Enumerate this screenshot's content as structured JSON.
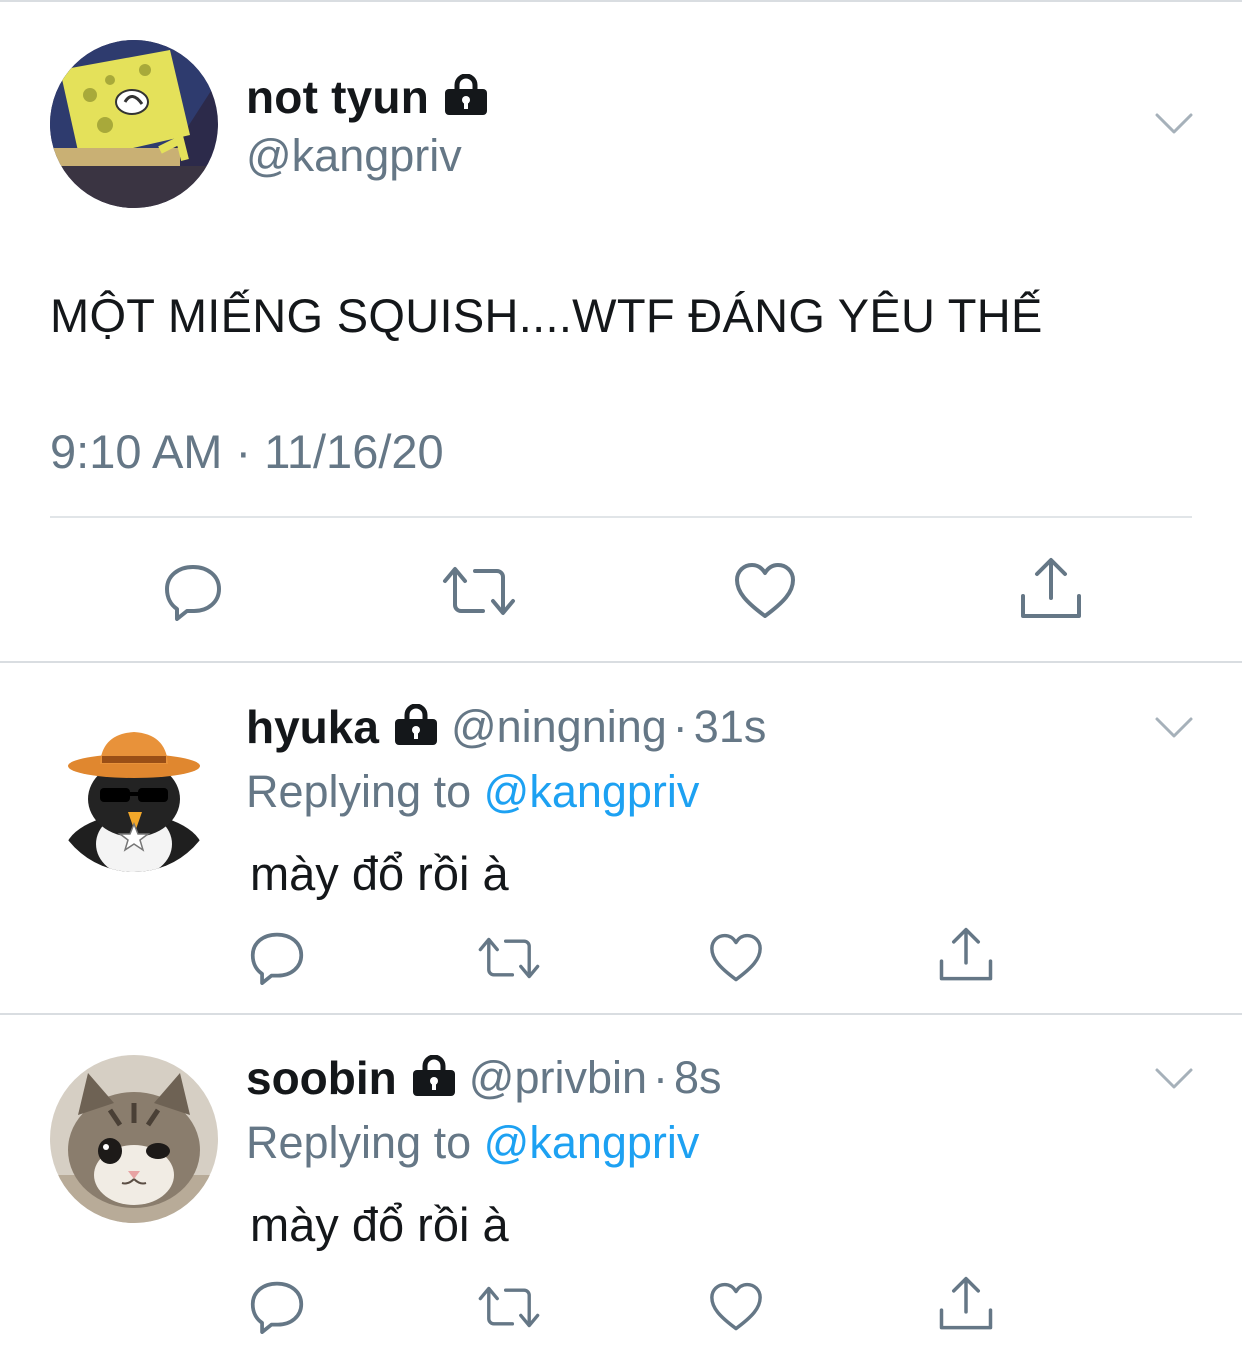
{
  "colors": {
    "text_primary": "#14171a",
    "text_secondary": "#657786",
    "link": "#1da1f2",
    "divider": "#e1e5e8",
    "icon": "#657786"
  },
  "main_tweet": {
    "display_name": "not tyun",
    "handle": "@kangpriv",
    "protected_icon": "lock-icon",
    "text": "MỘT MIẾNG SQUISH....WTF ĐÁNG YÊU THẾ",
    "timestamp": "9:10 AM · 11/16/20",
    "actions": [
      "reply-icon",
      "retweet-icon",
      "like-icon",
      "share-icon"
    ]
  },
  "replies": [
    {
      "display_name": "hyuka",
      "handle": "@ningning",
      "separator": "·",
      "age": "31s",
      "replying_prefix": "Replying to ",
      "replying_to": "@kangpriv",
      "text": "mày đổ rồi à"
    },
    {
      "display_name": "soobin",
      "handle": "@privbin",
      "separator": "·",
      "age": "8s",
      "replying_prefix": "Replying to ",
      "replying_to": "@kangpriv",
      "text": "mày đổ rồi à"
    }
  ]
}
